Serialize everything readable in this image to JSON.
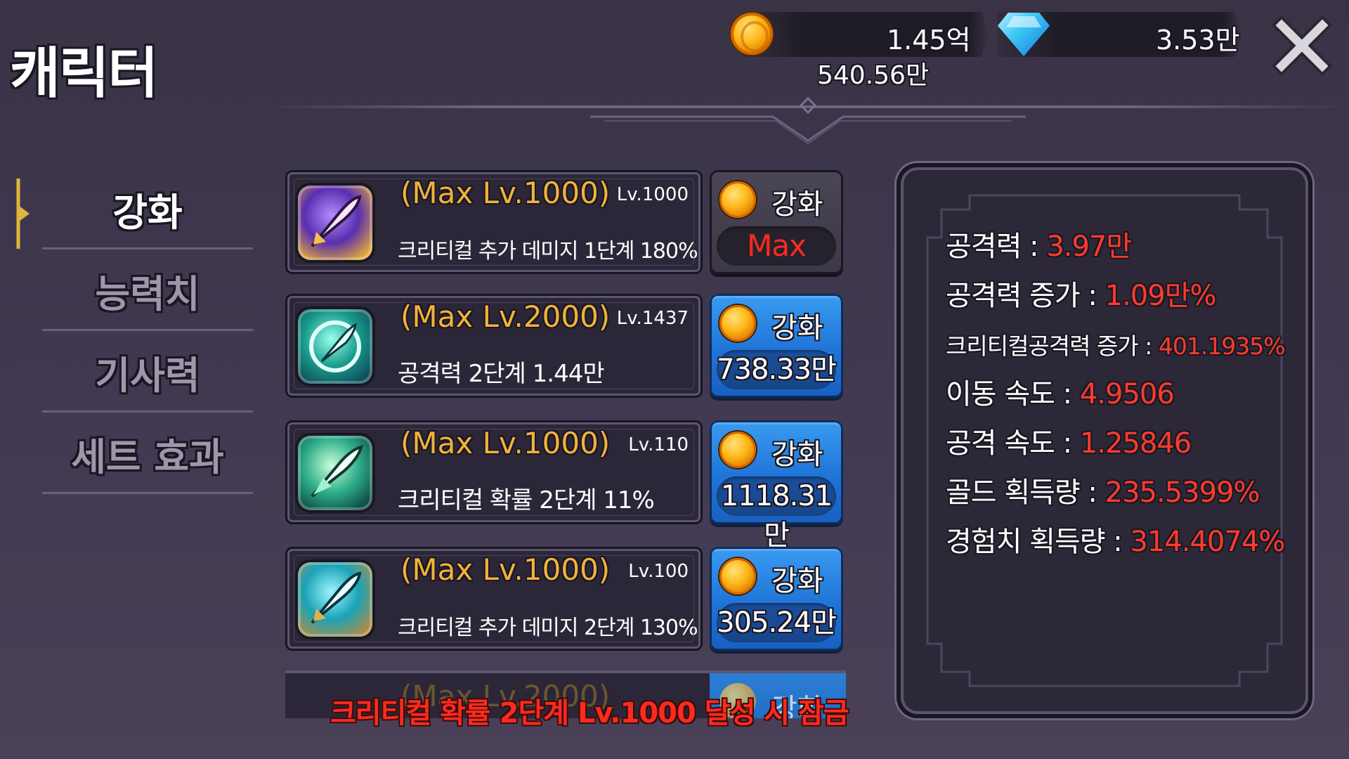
{
  "header": {
    "title": "캐릭터",
    "gold": "1.45억",
    "gems": "3.53만",
    "gold_sub": "540.56만"
  },
  "tabs": [
    {
      "label": "강화",
      "active": true
    },
    {
      "label": "능력치",
      "active": false
    },
    {
      "label": "기사력",
      "active": false
    },
    {
      "label": "세트 효과",
      "active": false
    }
  ],
  "upgrades": [
    {
      "max_level": "(Max Lv.1000)",
      "level": "Lv.1000",
      "effect": "크리티컬 추가 데미지 1단계 180%",
      "button": "강화",
      "cost": "Max",
      "icon": "critical-damage-purple-icon"
    },
    {
      "max_level": "(Max Lv.2000)",
      "level": "Lv.1437",
      "effect": "공격력 2단계 1.44만",
      "button": "강화",
      "cost": "738.33만",
      "icon": "attack-teal-icon"
    },
    {
      "max_level": "(Max Lv.1000)",
      "level": "Lv.110",
      "effect": "크리티컬 확률 2단계 11%",
      "button": "강화",
      "cost": "1118.31만",
      "icon": "critical-rate-green-icon"
    },
    {
      "max_level": "(Max Lv.1000)",
      "level": "Lv.100",
      "effect": "크리티컬 추가 데미지 2단계 130%",
      "button": "강화",
      "cost": "305.24만",
      "icon": "critical-damage-teal-icon"
    }
  ],
  "partial_row": {
    "max_level": "(Max Lv.2000)",
    "button": "강화"
  },
  "notice": "크리티컬 확률 2단계 Lv.1000 달성 시 잠금",
  "stats": [
    {
      "label": "공격력 : ",
      "value": "3.97만"
    },
    {
      "label": "공격력 증가 : ",
      "value": "1.09만%"
    },
    {
      "label": "크리티컬공격력 증가 : ",
      "value": "401.1935%"
    },
    {
      "label": "이동 속도 : ",
      "value": "4.9506"
    },
    {
      "label": "공격 속도 : ",
      "value": "1.25846"
    },
    {
      "label": "골드 획득량 : ",
      "value": "235.5399%"
    },
    {
      "label": "경험치 획득량 : ",
      "value": "314.4074%"
    }
  ],
  "colors": {
    "accent_gold": "#f3b23a",
    "stat_value_red": "#ff3b2d",
    "button_blue": "#1f74d6"
  }
}
